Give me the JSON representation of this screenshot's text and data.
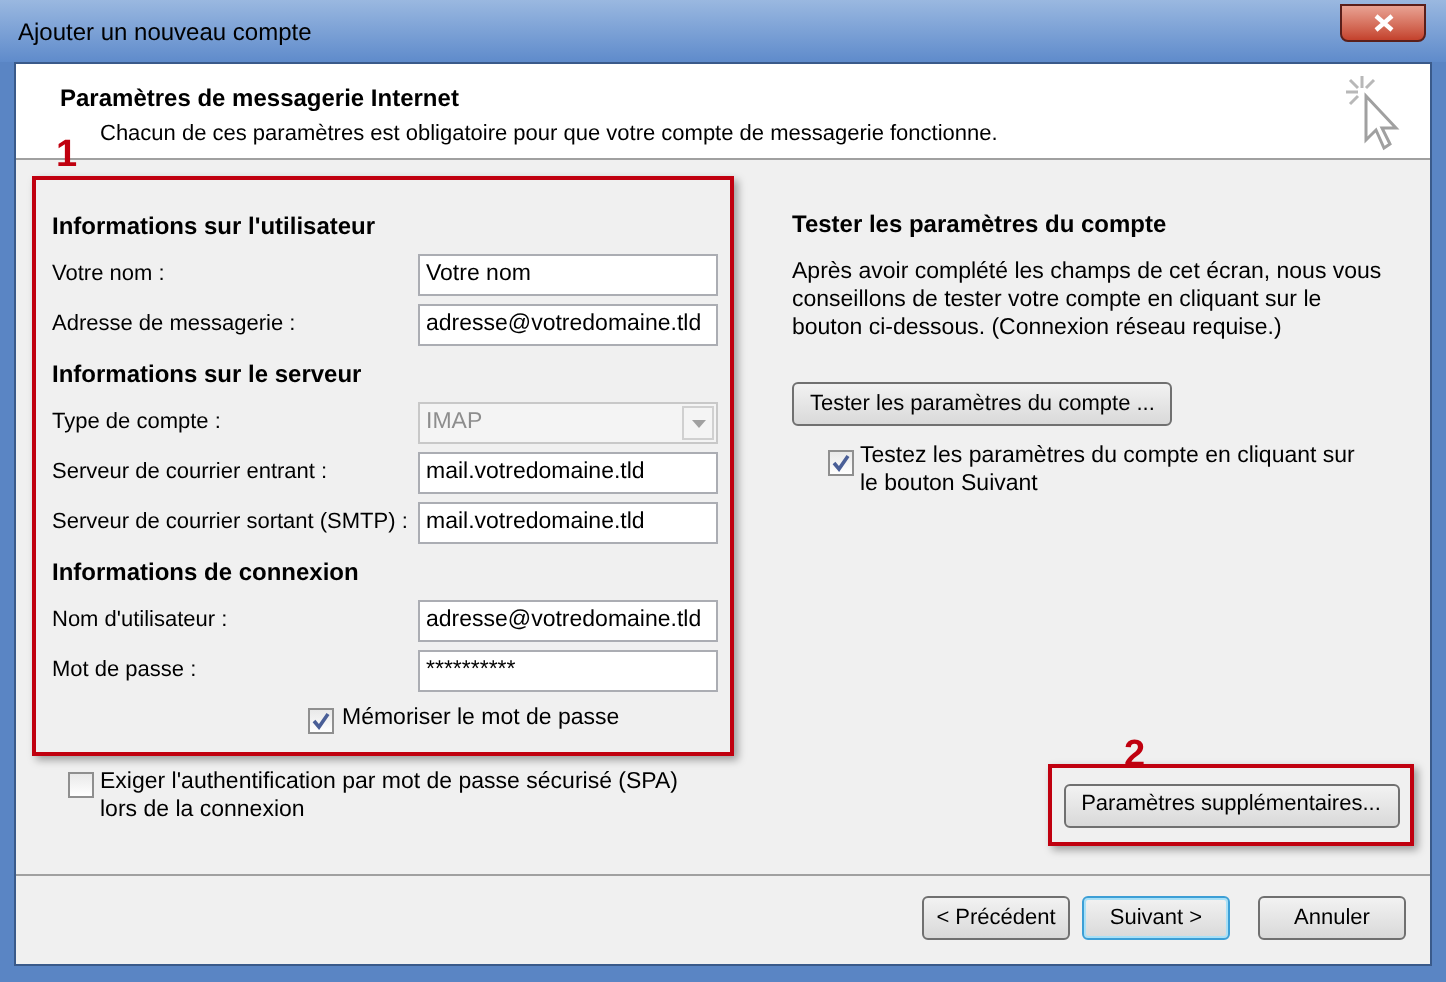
{
  "window": {
    "title": "Ajouter un nouveau compte"
  },
  "header": {
    "title": "Paramètres de messagerie Internet",
    "subtitle": "Chacun de ces paramètres est obligatoire pour que votre compte de messagerie fonctionne."
  },
  "annotations": [
    "1",
    "2"
  ],
  "form": {
    "rows": [
      {
        "kind": "heading",
        "label": "Informations sur l'utilisateur"
      },
      {
        "kind": "text",
        "label": "Votre nom :",
        "value": "Votre nom"
      },
      {
        "kind": "text",
        "label": "Adresse de messagerie :",
        "value": "adresse@votredomaine.tld"
      },
      {
        "kind": "heading",
        "label": "Informations sur le serveur"
      },
      {
        "kind": "combo",
        "label": "Type de compte :",
        "value": "IMAP",
        "disabled": true
      },
      {
        "kind": "text",
        "label": "Serveur de courrier entrant :",
        "value": "mail.votredomaine.tld"
      },
      {
        "kind": "text",
        "label": "Serveur de courrier sortant (SMTP) :",
        "value": "mail.votredomaine.tld"
      },
      {
        "kind": "heading",
        "label": "Informations de connexion"
      },
      {
        "kind": "text",
        "label": "Nom d'utilisateur :",
        "value": "adresse@votredomaine.tld"
      },
      {
        "kind": "text",
        "label": "Mot de passe :",
        "value": "**********"
      }
    ],
    "remember": {
      "label": "Mémoriser le mot de passe",
      "checked": true
    }
  },
  "spa": {
    "label": "Exiger l'authentification par mot de passe sécurisé (SPA) lors de la connexion",
    "checked": false
  },
  "test": {
    "title": "Tester les paramètres du compte",
    "description": "Après avoir complété les champs de cet écran, nous vous conseillons de tester votre compte en cliquant sur le bouton ci-dessous. (Connexion réseau requise.)",
    "button": "Tester les paramètres du compte ...",
    "auto": {
      "label": "Testez les paramètres du compte en cliquant sur le bouton Suivant",
      "checked": true
    }
  },
  "more_button": "Paramètres supplémentaires...",
  "buttons": [
    {
      "label": "< Précédent",
      "default": false
    },
    {
      "label": "Suivant >",
      "default": true
    },
    {
      "label": "Annuler",
      "default": false
    }
  ]
}
